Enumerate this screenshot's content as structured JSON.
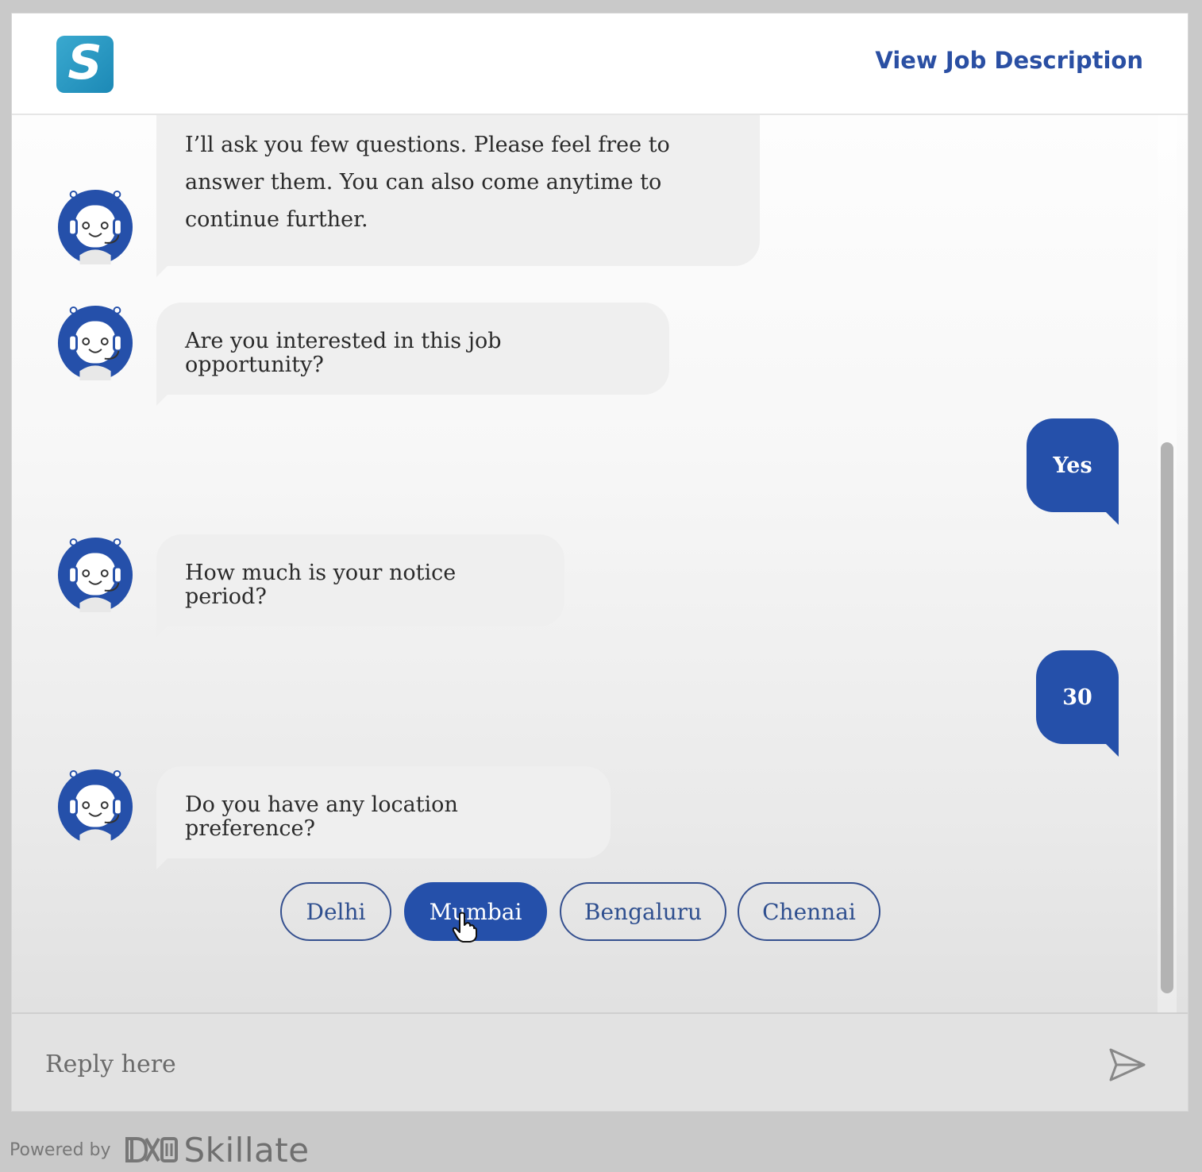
{
  "header": {
    "logo_letter": "S",
    "view_job_label": "View Job Description"
  },
  "messages": [
    {
      "from": "bot",
      "lines": [
        "I’ll ask you few questions. Please feel free to",
        "answer them. You can also come anytime to",
        "continue further."
      ]
    },
    {
      "from": "bot",
      "text": "Are you interested in this job opportunity?"
    },
    {
      "from": "user",
      "text": "Yes"
    },
    {
      "from": "bot",
      "text": "How much is your notice period?"
    },
    {
      "from": "user",
      "text": "30"
    },
    {
      "from": "bot",
      "text": "Do you have any location preference?"
    }
  ],
  "options": [
    {
      "label": "Delhi",
      "selected": false
    },
    {
      "label": "Mumbai",
      "selected": true
    },
    {
      "label": "Bengaluru",
      "selected": false
    },
    {
      "label": "Chennai",
      "selected": false
    }
  ],
  "input": {
    "placeholder": "Reply here"
  },
  "footer": {
    "powered_by": "Powered by",
    "brand": "Skillate"
  },
  "colors": {
    "accent": "#2550aa",
    "logo": "#2aa0c8",
    "bot_bubble": "#efefef"
  },
  "icons": [
    "bot-avatar-icon",
    "send-icon",
    "hand-cursor-icon",
    "skillate-logo-icon"
  ]
}
